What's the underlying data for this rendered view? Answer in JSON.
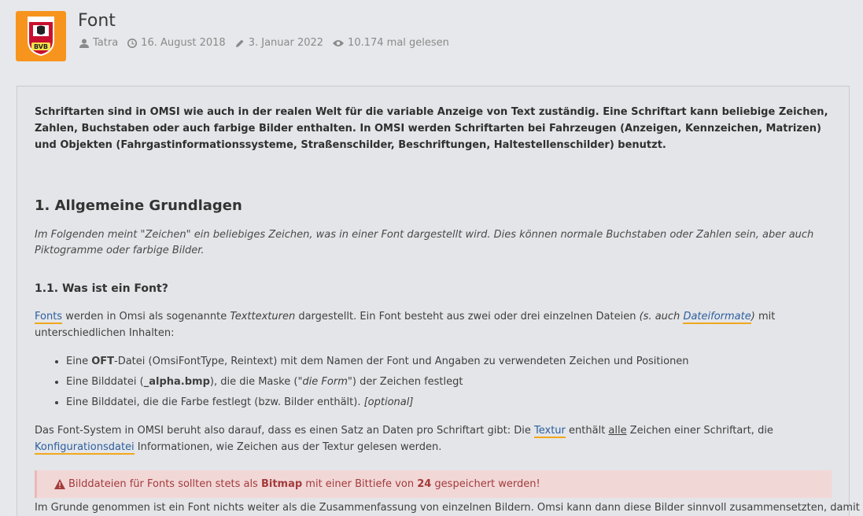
{
  "header": {
    "title": "Font",
    "author": "Tatra",
    "created": "16. August 2018",
    "edited": "3. Januar 2022",
    "views": "10.174 mal gelesen",
    "avatar_label": "BVB"
  },
  "article": {
    "intro": "Schriftarten sind in OMSI wie auch in der realen Welt für die variable Anzeige von Text zuständig. Eine Schriftart kann beliebige Zeichen, Zahlen, Buchstaben oder auch farbige Bilder enthalten. In OMSI werden Schriftarten bei Fahrzeugen (Anzeigen, Kennzeichen, Matrizen) und Objekten (Fahrgastinformationssysteme, Straßenschilder, Beschriftungen, Haltestellenschilder) benutzt.",
    "h2": "1. Allgemeine Grundlagen",
    "italic_note": "Im Folgenden meint \"Zeichen\" ein beliebiges Zeichen, was in einer Font dargestellt wird. Dies können normale Buchstaben oder Zahlen sein, aber auch Piktogramme oder farbige Bilder.",
    "h3": "1.1. Was ist ein Font?",
    "p1": {
      "link_fonts": "Fonts",
      "t1": " werden in Omsi als sogenannte ",
      "t_italic": "Texttexturen",
      "t2": " dargestellt. Ein Font besteht aus zwei oder drei einzelnen Dateien ",
      "t_paren_open": "(s. auch ",
      "link_formats": "Dateiformate",
      "t_paren_close": ")",
      "t3": " mit unterschiedlichen Inhalten:"
    },
    "list": [
      {
        "a": "Eine ",
        "b": "OFT",
        "c": "-Datei (OmsiFontType, Reintext) mit dem Namen der Font und Angaben zu verwendeten Zeichen und Positionen"
      },
      {
        "a": "Eine Bilddatei (",
        "b": "_alpha.bmp",
        "c": "), die die Maske (",
        "d": "\"die Form\"",
        "e": ") der Zeichen festlegt"
      },
      {
        "a": "Eine Bilddatei, die die Farbe festlegt (bzw. Bilder enthält). ",
        "b": "[optional]"
      }
    ],
    "p2": {
      "t1": "Das Font-System in OMSI beruht also darauf, dass es einen Satz an Daten pro Schriftart gibt: Die ",
      "link_textur": "Textur",
      "t2": " enthält ",
      "t_u": "alle",
      "t3": " Zeichen einer Schriftart, die ",
      "link_config": "Konfigurationsdatei",
      "t4": " Informationen, wie Zeichen aus der Textur gelesen werden."
    },
    "warning": {
      "t1": "Bilddateien für Fonts sollten stets als ",
      "b1": "Bitmap",
      "t2": " mit einer Bittiefe von ",
      "b2": "24",
      "t3": " gespeichert werden!"
    },
    "p3": "Im Grunde genommen ist ein Font nichts weiter als die Zusammenfassung von einzelnen Bildern. Omsi kann dann diese Bilder sinnvoll zusammensetzten, damit es"
  },
  "colors": {
    "accent": "#f7941d",
    "link": "#2c5e9e",
    "warning_bg": "#f2d7d7",
    "warning_text": "#a33b3b"
  }
}
